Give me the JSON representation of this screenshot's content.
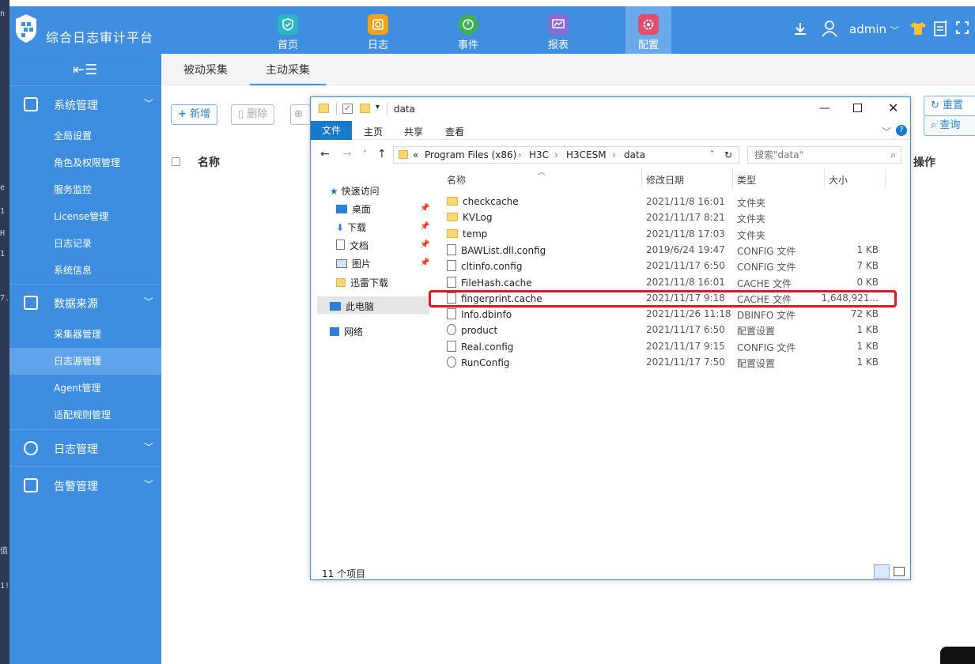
{
  "app": {
    "title": "综合日志审计平台",
    "user": "admin",
    "nav": [
      {
        "label": "首页",
        "color": "#2bb6c6",
        "icon": "home-shield-icon"
      },
      {
        "label": "日志",
        "color": "#f0a21b",
        "icon": "log-icon"
      },
      {
        "label": "事件",
        "color": "#3fae5a",
        "icon": "gauge-icon"
      },
      {
        "label": "报表",
        "color": "#8a6bd6",
        "icon": "chart-icon"
      },
      {
        "label": "配置",
        "color": "#e0506c",
        "icon": "settings-icon"
      }
    ]
  },
  "sidebar": {
    "sections": [
      {
        "label": "系统管理",
        "items": [
          "全局设置",
          "角色及权限管理",
          "服务监控",
          "License管理",
          "日志记录",
          "系统信息"
        ]
      },
      {
        "label": "数据来源",
        "items": [
          "采集器管理",
          "日志源管理",
          "Agent管理",
          "适配规则管理"
        ]
      },
      {
        "label": "日志管理"
      },
      {
        "label": "告警管理"
      }
    ]
  },
  "main": {
    "tabs": [
      "被动采集",
      "主动采集"
    ],
    "buttons": {
      "add": "新增",
      "delete": "删除",
      "reset": "重置",
      "query": "查询"
    },
    "table_headers": {
      "name": "名称",
      "ops": "操作"
    }
  },
  "explorer": {
    "title": "data",
    "ribbon": [
      "文件",
      "主页",
      "共享",
      "查看"
    ],
    "path": [
      "«",
      "Program Files (x86)",
      "H3C",
      "H3CESM",
      "data"
    ],
    "search_placeholder": "搜索\"data\"",
    "tree": [
      "快速访问",
      "桌面",
      "下载",
      "文档",
      "图片",
      "迅雷下载",
      "此电脑",
      "网络"
    ],
    "columns": [
      "名称",
      "修改日期",
      "类型",
      "大小"
    ],
    "files": [
      {
        "name": "checkcache",
        "date": "2021/11/8 16:01",
        "type": "文件夹",
        "size": "",
        "kind": "folder"
      },
      {
        "name": "KVLog",
        "date": "2021/11/17 8:21",
        "type": "文件夹",
        "size": "",
        "kind": "folder"
      },
      {
        "name": "temp",
        "date": "2021/11/8 17:03",
        "type": "文件夹",
        "size": "",
        "kind": "folder"
      },
      {
        "name": "BAWList.dll.config",
        "date": "2019/6/24 19:47",
        "type": "CONFIG 文件",
        "size": "1 KB",
        "kind": "doc"
      },
      {
        "name": "cltinfo.config",
        "date": "2021/11/17 6:50",
        "type": "CONFIG 文件",
        "size": "7 KB",
        "kind": "doc"
      },
      {
        "name": "FileHash.cache",
        "date": "2021/11/8 16:01",
        "type": "CACHE 文件",
        "size": "0 KB",
        "kind": "doc"
      },
      {
        "name": "fingerprint.cache",
        "date": "2021/11/17 9:18",
        "type": "CACHE 文件",
        "size": "1,648,921...",
        "kind": "doc"
      },
      {
        "name": "Info.dbinfo",
        "date": "2021/11/26 11:18",
        "type": "DBINFO 文件",
        "size": "72 KB",
        "kind": "doc"
      },
      {
        "name": "product",
        "date": "2021/11/17 6:50",
        "type": "配置设置",
        "size": "1 KB",
        "kind": "cfg"
      },
      {
        "name": "Real.config",
        "date": "2021/11/17 9:15",
        "type": "CONFIG 文件",
        "size": "1 KB",
        "kind": "doc"
      },
      {
        "name": "RunConfig",
        "date": "2021/11/17 7:50",
        "type": "配置设置",
        "size": "1 KB",
        "kind": "cfg"
      }
    ],
    "status": "11 个项目"
  }
}
